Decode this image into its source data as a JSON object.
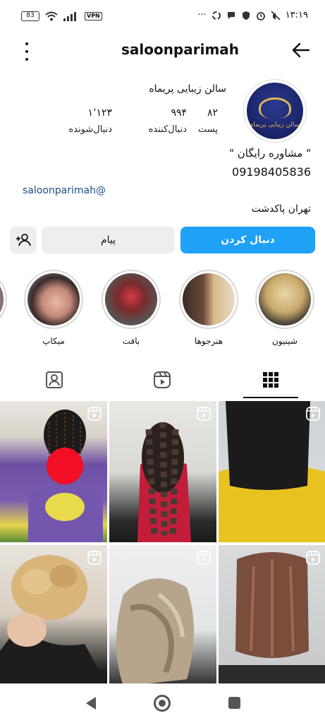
{
  "status_bar": {
    "battery": "83",
    "vpn": "VPN",
    "time": "۱۳:۱۹",
    "dots": "···"
  },
  "header": {
    "username": "saloonparimah"
  },
  "profile": {
    "name": "سالن زیبایی پریماه",
    "avatar_text": "سالن زیبایی پریماه",
    "stats": {
      "posts": {
        "value": "۸۲",
        "label": "پست"
      },
      "followers": {
        "value": "۹۹۴",
        "label": "دنبال‌کننده"
      },
      "following": {
        "value": "۱٬۱۲۳",
        "label": "دنبال‌شونده"
      }
    },
    "bio_line1": "\" مشاوره رایگان \"",
    "bio_phone": "09198405836",
    "bio_handle": "saloonparimah@",
    "location": "تهران پاکدشت"
  },
  "actions": {
    "follow_label": "دنبال کردن",
    "message_label": "پیام"
  },
  "highlights": [
    {
      "label": "شینیون"
    },
    {
      "label": "هنرجوها"
    },
    {
      "label": "بافت"
    },
    {
      "label": "میکاپ"
    }
  ],
  "colors": {
    "accent": "#1ea1f7",
    "link": "#1a4d86",
    "button_gray": "#eeeeee"
  },
  "icons": {
    "menu": "more-vertical-icon",
    "back": "arrow-left-icon",
    "add_user": "add-user-icon",
    "grid": "grid-icon",
    "reels": "reels-icon",
    "tagged": "tagged-icon"
  }
}
